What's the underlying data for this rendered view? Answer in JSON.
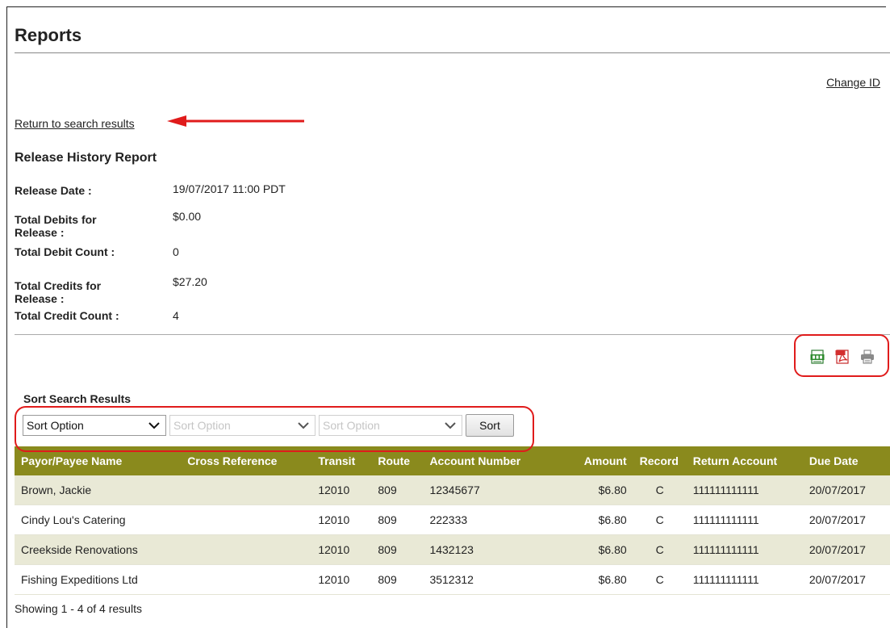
{
  "page": {
    "title": "Reports"
  },
  "header": {
    "change_id": "Change ID"
  },
  "nav": {
    "return_link": "Return to search results"
  },
  "report": {
    "title": "Release History Report",
    "fields": {
      "release_date_label": "Release Date :",
      "release_date": "19/07/2017 11:00 PDT",
      "total_debits_label_1": "Total Debits for",
      "total_debits_label_2": "Release :",
      "total_debits": "$0.00",
      "debit_count_label": "Total Debit Count :",
      "debit_count": "0",
      "total_credits_label_1": "Total Credits for",
      "total_credits_label_2": "Release :",
      "total_credits": "$27.20",
      "credit_count_label": "Total Credit Count :",
      "credit_count": "4"
    }
  },
  "export_icons": [
    "csv-icon",
    "pdf-icon",
    "print-icon"
  ],
  "sort": {
    "label": "Sort Search Results",
    "option1": "Sort Option",
    "option2": "Sort Option",
    "option3": "Sort Option",
    "button": "Sort"
  },
  "table": {
    "headers": {
      "name": "Payor/Payee Name",
      "xref": "Cross Reference",
      "transit": "Transit",
      "route": "Route",
      "account": "Account Number",
      "amount": "Amount",
      "record": "Record",
      "return_account": "Return Account",
      "due_date": "Due Date"
    },
    "rows": [
      {
        "name": "Brown, Jackie",
        "xref": "",
        "transit": "12010",
        "route": "809",
        "account": "12345677",
        "amount": "$6.80",
        "record": "C",
        "return_account": "111111111111",
        "due_date": "20/07/2017"
      },
      {
        "name": "Cindy Lou's Catering",
        "xref": "",
        "transit": "12010",
        "route": "809",
        "account": "222333",
        "amount": "$6.80",
        "record": "C",
        "return_account": "111111111111",
        "due_date": "20/07/2017"
      },
      {
        "name": "Creekside Renovations",
        "xref": "",
        "transit": "12010",
        "route": "809",
        "account": "1432123",
        "amount": "$6.80",
        "record": "C",
        "return_account": "111111111111",
        "due_date": "20/07/2017"
      },
      {
        "name": "Fishing Expeditions Ltd",
        "xref": "",
        "transit": "12010",
        "route": "809",
        "account": "3512312",
        "amount": "$6.80",
        "record": "C",
        "return_account": "111111111111",
        "due_date": "20/07/2017"
      }
    ]
  },
  "footer": {
    "showing": "Showing 1 - 4 of 4 results"
  },
  "colors": {
    "header_bg": "#8a8a1d",
    "alt_row_bg": "#e9e9d6",
    "highlight": "#e01b1b"
  }
}
